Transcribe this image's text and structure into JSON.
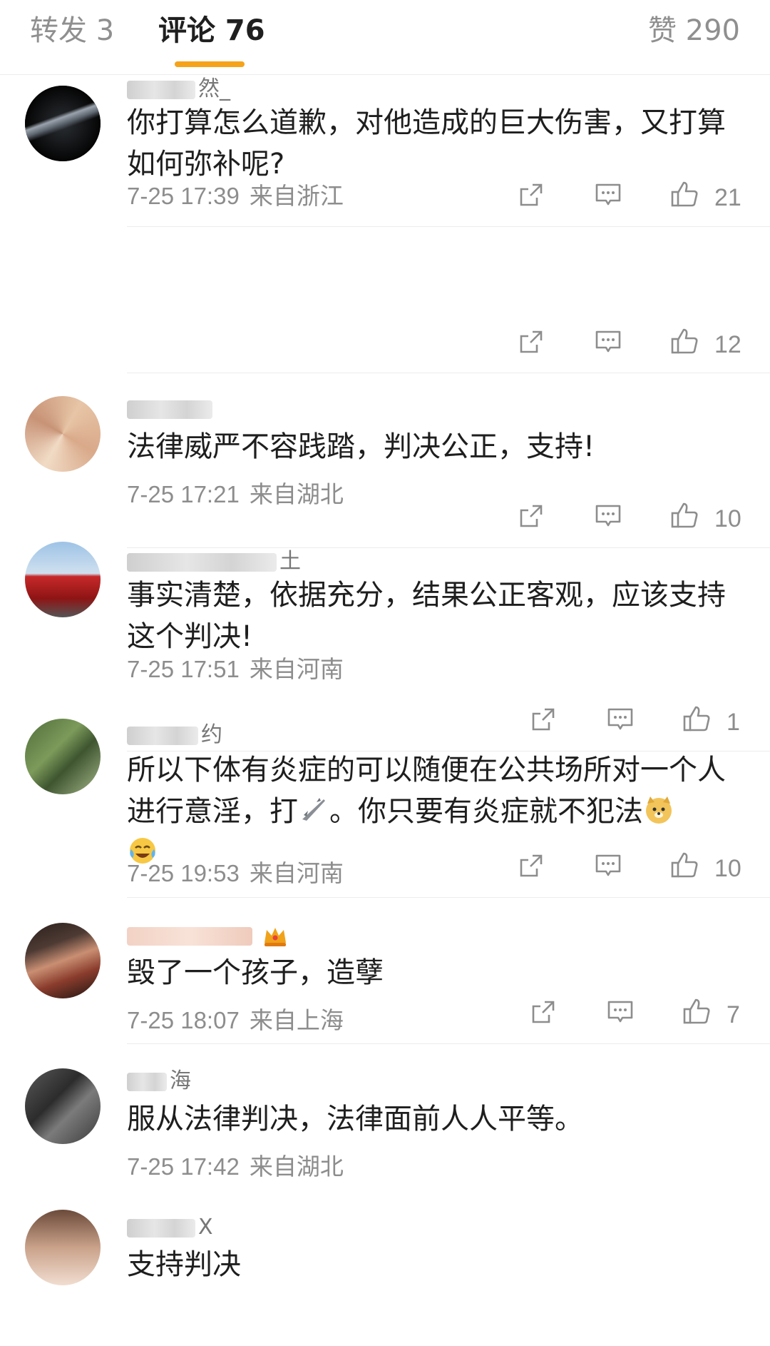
{
  "tabs": {
    "repost": "转发 3",
    "comments": "评论 76",
    "likes": "赞 290"
  },
  "colors": {
    "accent": "#f5a31a",
    "meta": "#8d8d8d"
  },
  "icons": {
    "share": "share-icon",
    "reply": "comment-icon",
    "like": "thumbs-up-icon"
  },
  "comments": [
    {
      "username": "然_",
      "text": "你打算怎么道歉，对他造成的巨大伤害，又打算如何弥补呢?",
      "time": "7-25 17:39",
      "location": "来自浙江",
      "likes": "21"
    },
    {
      "username": "",
      "text": "法律威严不容践踏，判决公正，支持!",
      "time": "7-25 17:21",
      "location": "来自湖北",
      "likes": "12"
    },
    {
      "username": "土",
      "text": "事实清楚，依据充分，结果公正客观，应该支持这个判决!",
      "time": "7-25 17:51",
      "location": "来自河南",
      "likes": "10"
    },
    {
      "username": "约",
      "text_part1": "所以下体有炎症的可以随便在公共场所对一个人进行意淫，打",
      "text_part2": "。你只要有炎症就不犯法",
      "time": "7-25 19:53",
      "location": "来自河南",
      "likes": "1"
    },
    {
      "username": "",
      "text": "毁了一个孩子，造孽",
      "time": "7-25 18:07",
      "location": "来自上海",
      "likes": "10"
    },
    {
      "username": "海",
      "text": "服从法律判决，法律面前人人平等。",
      "time": "7-25 17:42",
      "location": "来自湖北",
      "likes": "7"
    },
    {
      "username": "X",
      "text": "支持判决"
    }
  ]
}
